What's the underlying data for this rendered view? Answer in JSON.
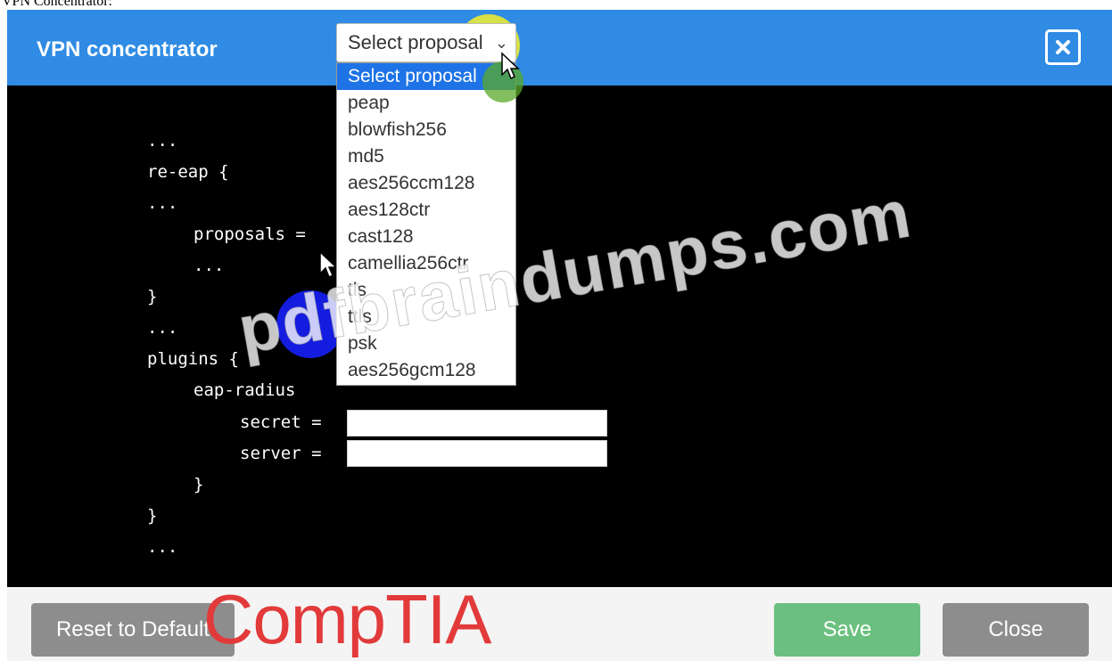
{
  "caption": "VPN Concentrator:",
  "dialog": {
    "title": "VPN concentrator",
    "close_icon": "close-icon",
    "accent": "#2f8be3"
  },
  "code_lines": [
    "...",
    "re-eap {",
    "...",
    "proposals =",
    "...",
    "}",
    "...",
    "plugins {",
    "eap-radius",
    "secret =",
    "server =",
    "}",
    "}",
    "..."
  ],
  "fields": {
    "secret": "",
    "server": ""
  },
  "proposal_select": {
    "selected": "Select proposal",
    "options": [
      "Select proposal",
      "peap",
      "blowfish256",
      "md5",
      "aes256ccm128",
      "aes128ctr",
      "cast128",
      "camellia256ctr",
      "tls",
      "ttls",
      "psk",
      "aes256gcm128"
    ]
  },
  "buttons": {
    "reset": "Reset to Default",
    "save": "Save",
    "close": "Close"
  },
  "colors": {
    "save": "#6bc07f",
    "gray": "#8d8d8d",
    "selected_option": "#1e73e6"
  },
  "watermark": "pdfbraindumps.com",
  "logo": "CompTIA"
}
